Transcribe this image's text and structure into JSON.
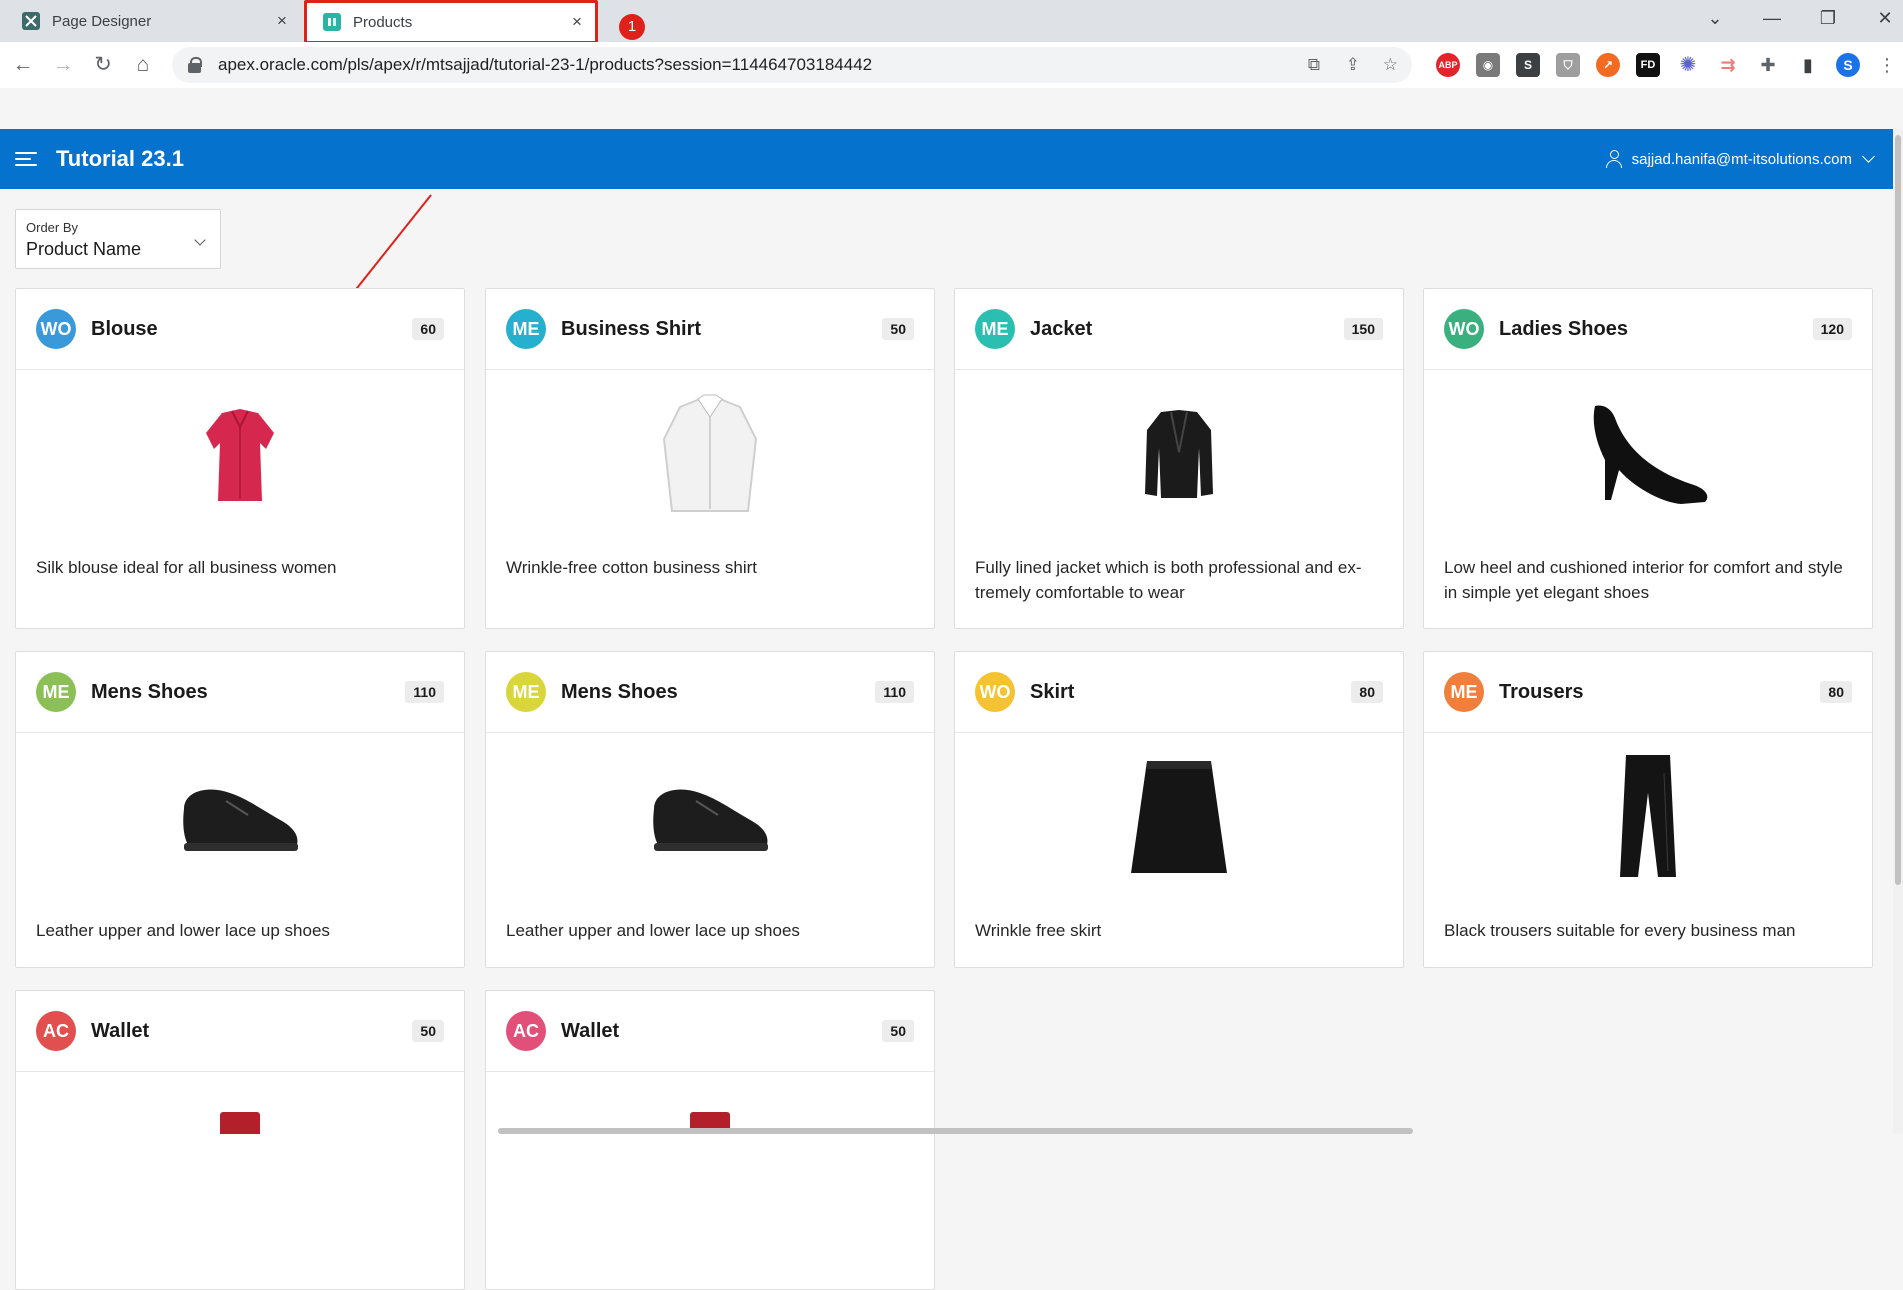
{
  "browser": {
    "tabs": [
      {
        "title": "Page Designer",
        "close": "×"
      },
      {
        "title": "Products",
        "close": "×"
      }
    ],
    "callout_number": "1",
    "window_controls": {
      "dropdown": "⌄",
      "minimize": "—",
      "restore": "❐",
      "close": "✕"
    },
    "url": "apex.oracle.com/pls/apex/r/mtsajjad/tutorial-23-1/products?session=114464703184442",
    "profile_initial": "S",
    "extensions": [
      {
        "name": "adblock-plus-icon",
        "text": "ABP",
        "color": "#e3242b"
      },
      {
        "name": "camera-icon",
        "text": "◉",
        "color": "#7a7a7a"
      },
      {
        "name": "s-extension-icon",
        "text": "S",
        "color": "#3c4043"
      },
      {
        "name": "shield-icon",
        "text": "⛉",
        "color": "#9e9e9e"
      },
      {
        "name": "orange-extension-icon",
        "text": "↗",
        "color": "#f26b21"
      },
      {
        "name": "fd-extension-icon",
        "text": "FD",
        "color": "#111111"
      },
      {
        "name": "star-burst-icon",
        "text": "✺",
        "color": "#5b5fd6"
      },
      {
        "name": "forward-share-icon",
        "text": "⇉",
        "color": "#f07a7a"
      },
      {
        "name": "puzzle-icon",
        "text": "✚",
        "color": "#5f6368"
      },
      {
        "name": "sidepanel-icon",
        "text": "▮",
        "color": "#3c4043"
      }
    ]
  },
  "app": {
    "title": "Tutorial 23.1",
    "user": "sajjad.hanifa@mt-itsolutions.com",
    "order_by": {
      "label": "Order By",
      "value": "Product Name"
    }
  },
  "products": [
    {
      "initials": "WO",
      "color": "#3a9ad9",
      "name": "Blouse",
      "count": "60",
      "image": "blouse",
      "description": "Silk blouse ideal for all business women"
    },
    {
      "initials": "ME",
      "color": "#26b0cf",
      "name": "Business Shirt",
      "count": "50",
      "image": "shirt",
      "description": "Wrinkle-free cotton business shirt"
    },
    {
      "initials": "ME",
      "color": "#2bbfb1",
      "name": "Jacket",
      "count": "150",
      "image": "jacket",
      "description": "Fully lined jacket which is both professional and ex-tremely comfortable to wear"
    },
    {
      "initials": "WO",
      "color": "#3bb07f",
      "name": "Ladies Shoes",
      "count": "120",
      "image": "heel",
      "description": "Low heel and cushioned interior for comfort and style in simple yet elegant shoes"
    },
    {
      "initials": "ME",
      "color": "#8cc056",
      "name": "Mens Shoes",
      "count": "110",
      "image": "shoe",
      "description": "Leather upper and lower lace up shoes"
    },
    {
      "initials": "ME",
      "color": "#d9d53c",
      "name": "Mens Shoes",
      "count": "110",
      "image": "shoe",
      "description": "Leather upper and lower lace up shoes"
    },
    {
      "initials": "WO",
      "color": "#f5c232",
      "name": "Skirt",
      "count": "80",
      "image": "skirt",
      "description": "Wrinkle free skirt"
    },
    {
      "initials": "ME",
      "color": "#f07e3c",
      "name": "Trousers",
      "count": "80",
      "image": "trousers",
      "description": "Black trousers suitable for every business man"
    },
    {
      "initials": "AC",
      "color": "#e24f4f",
      "name": "Wallet",
      "count": "50",
      "image": "wallet",
      "description": ""
    },
    {
      "initials": "AC",
      "color": "#e2507a",
      "name": "Wallet",
      "count": "50",
      "image": "wallet",
      "description": ""
    }
  ]
}
